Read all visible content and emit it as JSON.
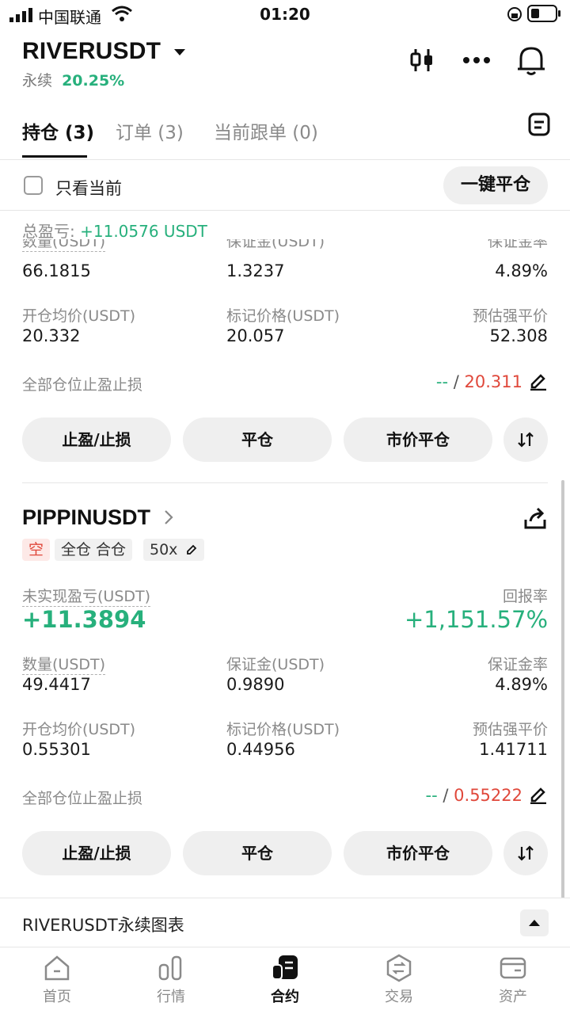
{
  "status_bar": {
    "carrier": "中国联通",
    "time": "01:20"
  },
  "header": {
    "symbol": "RIVERUSDT",
    "contract_type": "永续",
    "change_pct": "20.25%",
    "icons": [
      "candlestick-icon",
      "more-icon",
      "bell-icon"
    ]
  },
  "tabs": [
    {
      "label": "持仓 (3)",
      "active": true
    },
    {
      "label": "订单 (3)",
      "active": false
    },
    {
      "label": "当前跟单 (0)",
      "active": false
    }
  ],
  "filter": {
    "only_current_label": "只看当前",
    "close_all_label": "一键平仓"
  },
  "position1": {
    "total_pnl_label": "总盈亏:",
    "total_pnl_value": "+11.0576 USDT",
    "qty_label": "数量(USDT)",
    "qty_value": "66.1815",
    "margin_label": "保证金(USDT)",
    "margin_value": "1.3237",
    "margin_rate_label": "保证金率",
    "margin_rate_value": "4.89%",
    "entry_label": "开仓均价(USDT)",
    "entry_value": "20.332",
    "mark_label": "标记价格(USDT)",
    "mark_value": "20.057",
    "liq_label": "预估强平价",
    "liq_value": "52.308",
    "tpsl_label": "全部仓位止盈止损",
    "tpsl_tp": "--",
    "tpsl_sep": "/",
    "tpsl_sl": "20.311",
    "btn_tpsl": "止盈/止损",
    "btn_close": "平仓",
    "btn_market_close": "市价平仓"
  },
  "position2": {
    "symbol": "PIPPINUSDT",
    "side_tag": "空",
    "mode_tag": "全仓 合仓",
    "leverage_tag": "50x",
    "upnl_label": "未实现盈亏(USDT)",
    "upnl_value": "+11.3894",
    "roe_label": "回报率",
    "roe_value": "+1,151.57%",
    "qty_label": "数量(USDT)",
    "qty_value": "49.4417",
    "margin_label": "保证金(USDT)",
    "margin_value": "0.9890",
    "margin_rate_label": "保证金率",
    "margin_rate_value": "4.89%",
    "entry_label": "开仓均价(USDT)",
    "entry_value": "0.55301",
    "mark_label": "标记价格(USDT)",
    "mark_value": "0.44956",
    "liq_label": "预估强平价",
    "liq_value": "1.41711",
    "tpsl_label": "全部仓位止盈止损",
    "tpsl_tp": "--",
    "tpsl_sep": "/",
    "tpsl_sl": "0.55222",
    "btn_tpsl": "止盈/止损",
    "btn_close": "平仓",
    "btn_market_close": "市价平仓"
  },
  "chart_bar": {
    "label": "RIVERUSDT永续图表"
  },
  "tabbar": [
    {
      "label": "首页",
      "icon": "home-icon",
      "active": false
    },
    {
      "label": "行情",
      "icon": "market-icon",
      "active": false
    },
    {
      "label": "合约",
      "icon": "futures-icon",
      "active": true
    },
    {
      "label": "交易",
      "icon": "trade-icon",
      "active": false
    },
    {
      "label": "资产",
      "icon": "wallet-icon",
      "active": false
    }
  ],
  "colors": {
    "up": "#27b07c",
    "down": "#e0483b",
    "text": "#1b1b1b",
    "muted": "#8a8a8a"
  }
}
